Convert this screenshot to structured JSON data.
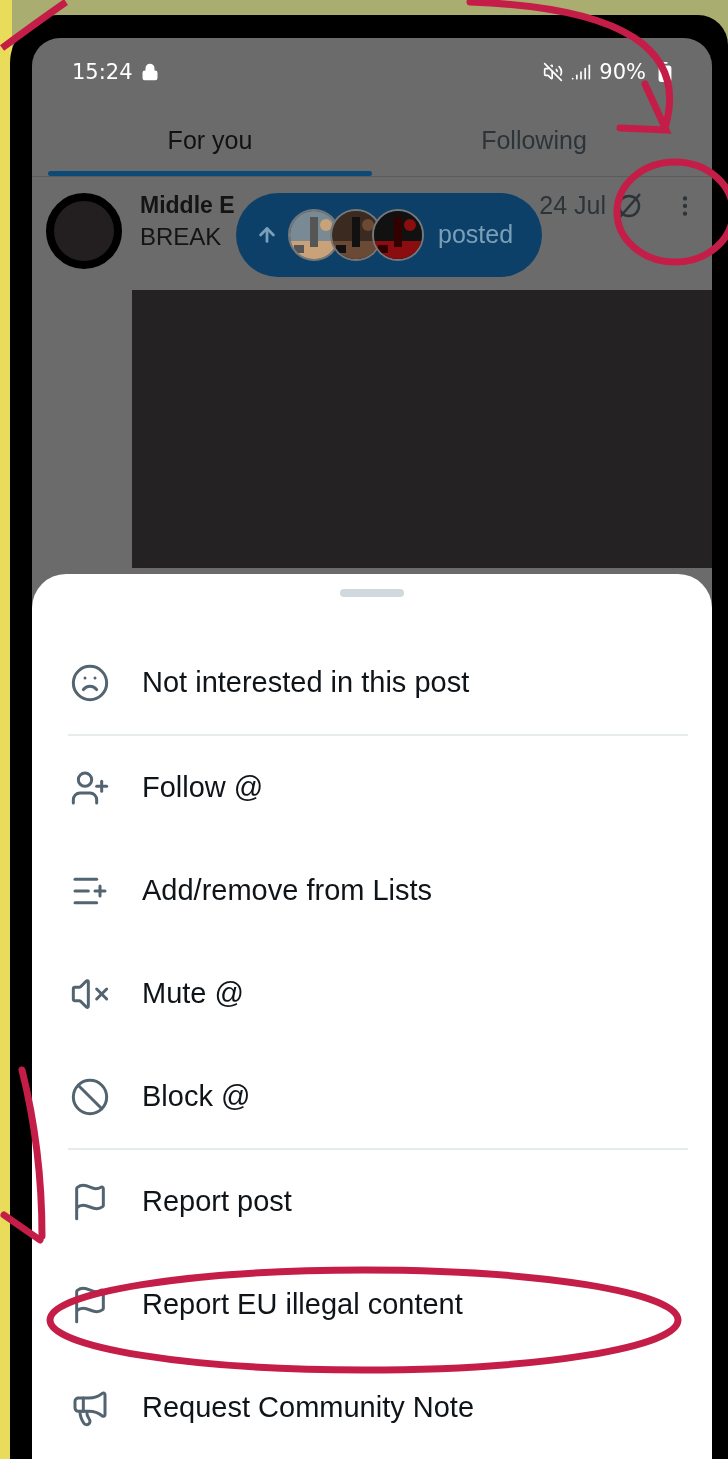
{
  "status_bar": {
    "time": "15:24",
    "battery": "90%"
  },
  "tabs": [
    {
      "label": "For you",
      "selected": true
    },
    {
      "label": "Following",
      "selected": false
    }
  ],
  "post": {
    "author": "Middle E",
    "date": "24 Jul",
    "text": "BREAK"
  },
  "new_posts_pill": {
    "label": "posted"
  },
  "menu": [
    {
      "kind": "frown",
      "label": "Not interested in this post",
      "divider_after": true
    },
    {
      "kind": "follow",
      "label": "Follow @",
      "divider_after": false
    },
    {
      "kind": "list",
      "label": "Add/remove from Lists",
      "divider_after": false
    },
    {
      "kind": "mute",
      "label": "Mute @",
      "divider_after": false
    },
    {
      "kind": "block",
      "label": "Block @",
      "divider_after": true
    },
    {
      "kind": "flag",
      "label": "Report post",
      "divider_after": false
    },
    {
      "kind": "flag",
      "label": "Report EU illegal content",
      "divider_after": false
    },
    {
      "kind": "megaphone",
      "label": "Request Community Note",
      "divider_after": false
    }
  ]
}
